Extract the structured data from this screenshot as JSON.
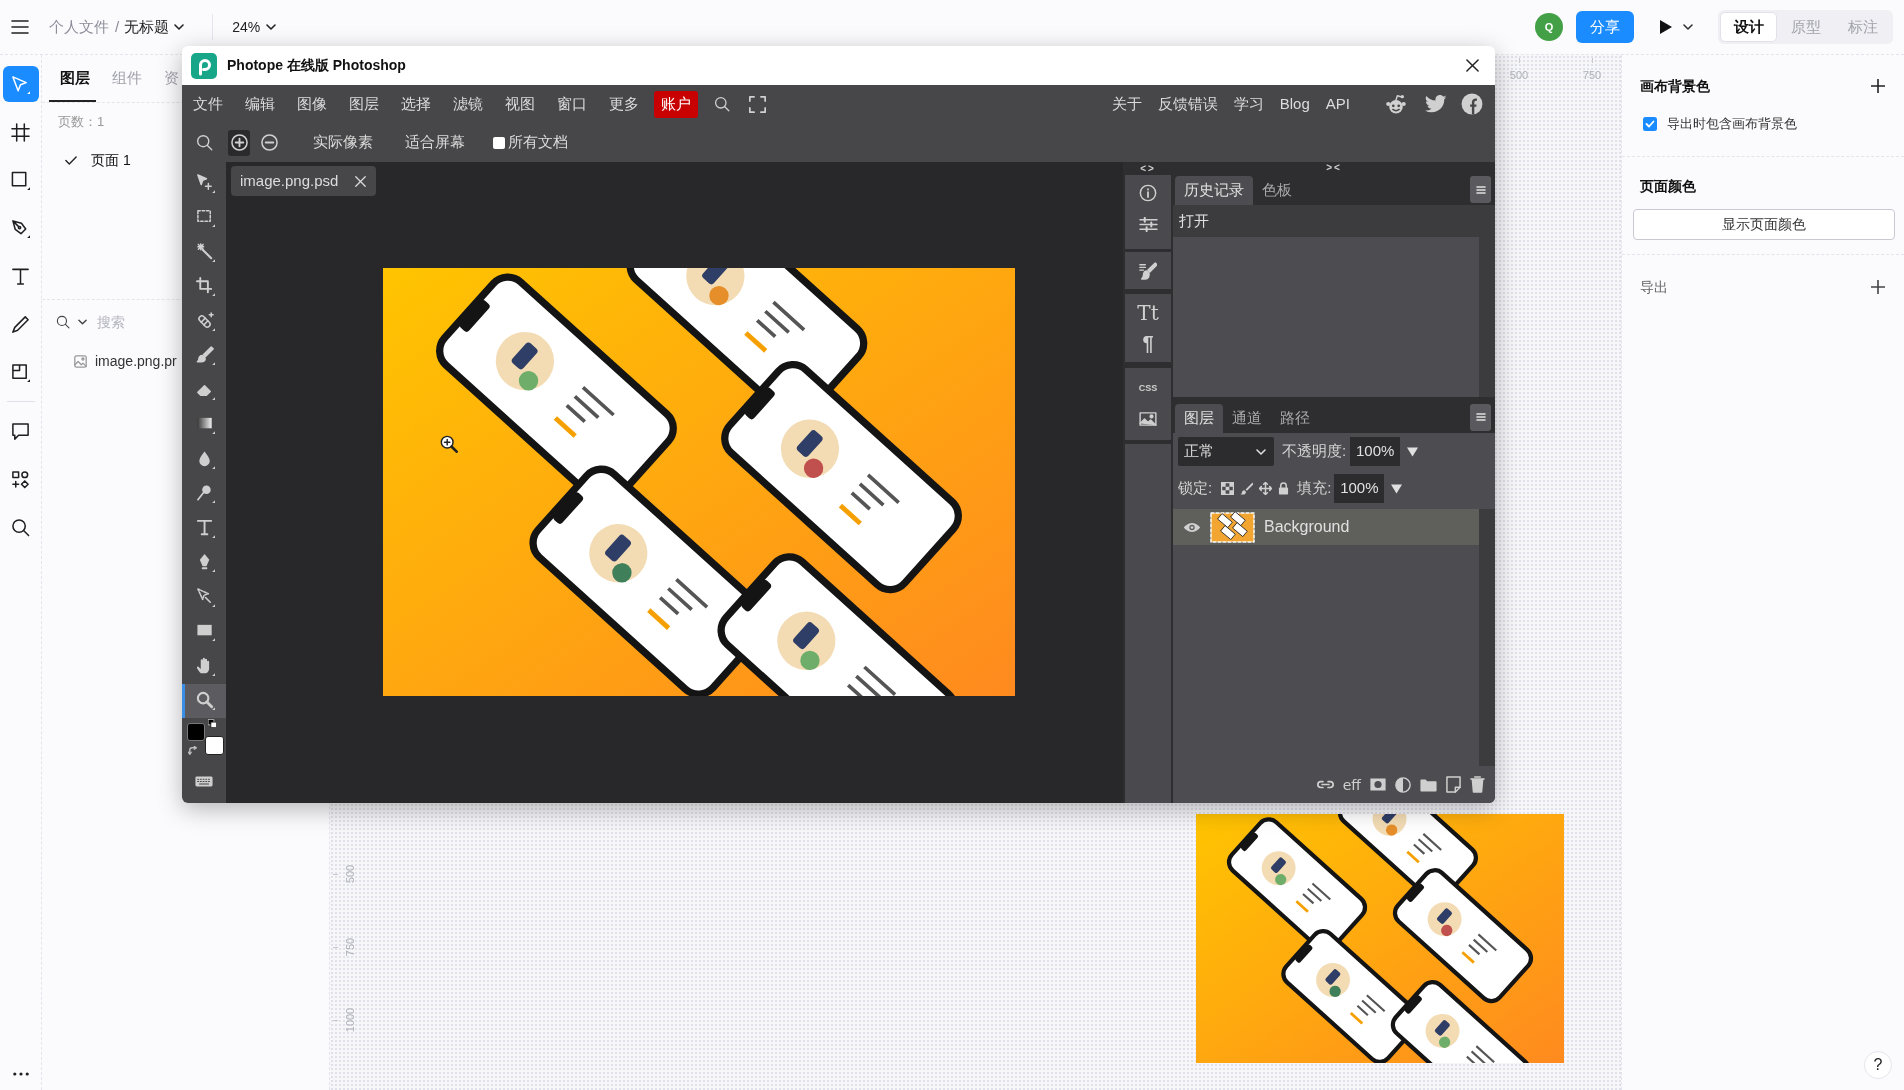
{
  "top_bar": {
    "folder": "个人文件",
    "separator": "/",
    "file": "无标题",
    "zoom": "24%",
    "avatar": "Q",
    "share": "分享",
    "mode_tabs": [
      {
        "label": "设计",
        "selected": true
      },
      {
        "label": "原型",
        "selected": false
      },
      {
        "label": "标注",
        "selected": false
      }
    ]
  },
  "tool_rail": [
    {
      "selected": true
    },
    {
      "selected": false
    },
    {
      "selected": false
    },
    {
      "selected": false
    },
    {
      "selected": false
    },
    {
      "selected": false
    },
    {
      "selected": false
    },
    {
      "selected": false
    },
    {
      "selected": false
    },
    {
      "selected": false
    }
  ],
  "left_panel": {
    "tabs": [
      {
        "label": "图层",
        "selected": true
      },
      {
        "label": "组件",
        "selected": false
      },
      {
        "label": "资",
        "selected": false
      }
    ],
    "page_count": "页数：1",
    "pages": [
      {
        "label": "页面 1",
        "selected": true
      }
    ],
    "search": {
      "placeholder": "搜索"
    },
    "layers": [
      {
        "name": "image.png.pr"
      }
    ]
  },
  "canvas": {
    "top_ruler": [
      "500",
      "750"
    ],
    "left_ruler": [
      "500",
      "750",
      "1000"
    ]
  },
  "editor": {
    "title": "Photope 在线版 Photoshop",
    "menu": [
      {
        "label": "文件",
        "highlighted": false
      },
      {
        "label": "编辑",
        "highlighted": false
      },
      {
        "label": "图像",
        "highlighted": false
      },
      {
        "label": "图层",
        "highlighted": false
      },
      {
        "label": "选择",
        "highlighted": false
      },
      {
        "label": "滤镜",
        "highlighted": false
      },
      {
        "label": "视图",
        "highlighted": false
      },
      {
        "label": "窗口",
        "highlighted": false
      },
      {
        "label": "更多",
        "highlighted": false
      },
      {
        "label": "账户",
        "highlighted": true
      }
    ],
    "links": [
      "关于",
      "反馈错误",
      "学习",
      "Blog",
      "API"
    ],
    "zoom_modes": [
      {
        "selected": true
      },
      {
        "selected": false
      }
    ],
    "zoom_buttons": [
      "实际像素",
      "适合屏幕"
    ],
    "all_documents": {
      "label": "所有文档",
      "checked": false
    },
    "tools": [
      {
        "selected": false
      },
      {
        "selected": false
      },
      {
        "selected": false
      },
      {
        "selected": false
      },
      {
        "selected": false
      },
      {
        "selected": false
      },
      {
        "selected": false
      },
      {
        "selected": false
      },
      {
        "selected": false
      },
      {
        "selected": false
      },
      {
        "selected": false
      },
      {
        "selected": false
      },
      {
        "selected": false
      },
      {
        "selected": false
      },
      {
        "selected": false
      },
      {
        "selected": true
      }
    ],
    "document": {
      "name": "image.png.psd"
    },
    "dock": {
      "left_toggle": "<>",
      "right_toggle": "><",
      "glyphs": [
        "Tt",
        "¶",
        "CSS"
      ]
    },
    "history": {
      "tabs": [
        {
          "label": "历史记录",
          "selected": true
        },
        {
          "label": "色板",
          "selected": false
        }
      ],
      "items": [
        {
          "label": "打开",
          "selected": true
        }
      ]
    },
    "layers": {
      "tabs": [
        {
          "label": "图层",
          "selected": true
        },
        {
          "label": "通道",
          "selected": false
        },
        {
          "label": "路径",
          "selected": false
        }
      ],
      "blend_mode": "正常",
      "opacity_label": "不透明度:",
      "opacity": "100%",
      "lock_label": "锁定:",
      "fill_label": "填充:",
      "fill": "100%",
      "items": [
        {
          "name": "Background",
          "visible": true,
          "selected": true
        }
      ],
      "effects": "eff"
    }
  },
  "right_panel": {
    "canvas_background": {
      "title": "画布背景色",
      "include_on_export": {
        "label": "导出时包含画布背景色",
        "checked": true
      }
    },
    "page_color": {
      "title": "页面颜色",
      "button": "显示页面颜色"
    },
    "export": {
      "title": "导出"
    }
  },
  "help": "?"
}
